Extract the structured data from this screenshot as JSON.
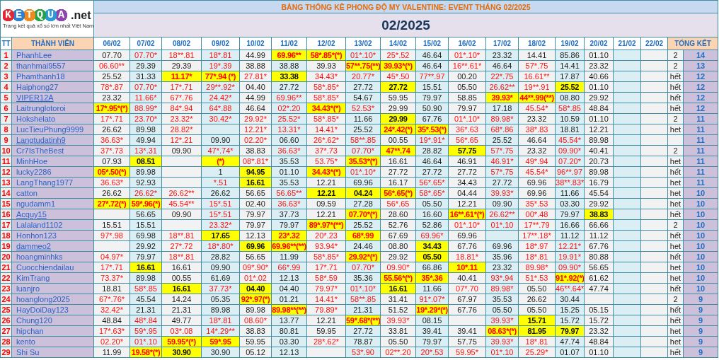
{
  "logo": {
    "letters": "KETQUA",
    "suffix": ".net",
    "tagline": "Trang kết quả xổ số lớn nhất Việt Nam"
  },
  "title": "BẢNG THỐNG KÊ PHONG ĐỘ MY VALENTINE: EVENT THÁNG 02/2025",
  "month": "02/2025",
  "columns": {
    "rank": "TT",
    "member": "THÀNH VIÊN",
    "dates": [
      "06/02",
      "07/02",
      "08/02",
      "09/02",
      "10/02",
      "11/02",
      "12/02",
      "13/02",
      "14/02",
      "15/02",
      "16/02",
      "17/02",
      "18/02",
      "19/02",
      "20/02",
      "21/02",
      "22/02"
    ],
    "summary": "TỔNG KẾT"
  },
  "rows": [
    {
      "rank": "1",
      "member": "PhanhLee",
      "link": false,
      "cells": [
        {
          "text": "07.70",
          "kind": "plain"
        },
        {
          "text": "07.70*",
          "kind": "red"
        },
        {
          "text": "18**.81",
          "kind": "red"
        },
        {
          "text": "18*.81",
          "kind": "red"
        },
        {
          "text": "44.99",
          "kind": "plain"
        },
        {
          "text": "69.96**",
          "kind": "hitred"
        },
        {
          "text": "58*.85*(*)",
          "kind": "hitred"
        },
        {
          "text": "01*.10*",
          "kind": "red"
        },
        {
          "text": "25*.52",
          "kind": "red"
        },
        {
          "text": "46.64",
          "kind": "plain"
        },
        {
          "text": "01*.10*",
          "kind": "red"
        },
        {
          "text": "23.32",
          "kind": "plain"
        },
        {
          "text": "14.41",
          "kind": "plain"
        },
        {
          "text": "85.86",
          "kind": "plain"
        },
        {
          "text": "01.10",
          "kind": "plain"
        }
      ],
      "status": "2",
      "total": "14"
    },
    {
      "rank": "2",
      "member": "thanhmai9557",
      "link": false,
      "cells": [
        {
          "text": "06.60**",
          "kind": "red"
        },
        {
          "text": "29.39",
          "kind": "plain"
        },
        {
          "text": "29.39",
          "kind": "plain"
        },
        {
          "text": "19*.39",
          "kind": "red"
        },
        {
          "text": "38.88",
          "kind": "plain"
        },
        {
          "text": "38.88",
          "kind": "plain"
        },
        {
          "text": "39.93",
          "kind": "plain"
        },
        {
          "text": "57**.75(**)",
          "kind": "hitred"
        },
        {
          "text": "39.93*(*)",
          "kind": "hitred"
        },
        {
          "text": "46.64",
          "kind": "plain"
        },
        {
          "text": "16**.61*",
          "kind": "red"
        },
        {
          "text": "46.64",
          "kind": "plain"
        },
        {
          "text": "57*.75",
          "kind": "red"
        },
        {
          "text": "14.41",
          "kind": "plain"
        },
        {
          "text": "23.32",
          "kind": "plain"
        }
      ],
      "status": "2",
      "total": "13"
    },
    {
      "rank": "3",
      "member": "Phamthanh18",
      "link": false,
      "cells": [
        {
          "text": "25.52",
          "kind": "plain"
        },
        {
          "text": "31.33",
          "kind": "plain"
        },
        {
          "text": "11.17*",
          "kind": "hitred"
        },
        {
          "text": "77*.94 (*)",
          "kind": "hitred"
        },
        {
          "text": "27.81*",
          "kind": "red"
        },
        {
          "text": "33.38",
          "kind": "hit"
        },
        {
          "text": "34.43*",
          "kind": "red"
        },
        {
          "text": "20.77*",
          "kind": "red"
        },
        {
          "text": "45*.50",
          "kind": "red"
        },
        {
          "text": "77**.97",
          "kind": "red"
        },
        {
          "text": "00.20",
          "kind": "plain"
        },
        {
          "text": "22*.75",
          "kind": "red"
        },
        {
          "text": "16.61**",
          "kind": "red"
        },
        {
          "text": "17.87",
          "kind": "plain"
        },
        {
          "text": "40.66",
          "kind": "plain"
        }
      ],
      "status": "hết",
      "total": "12"
    },
    {
      "rank": "4",
      "member": "Haiphong27",
      "link": false,
      "cells": [
        {
          "text": "78*.87",
          "kind": "red"
        },
        {
          "text": "07.70*",
          "kind": "red"
        },
        {
          "text": "17*.71",
          "kind": "red"
        },
        {
          "text": "29**.92*",
          "kind": "red"
        },
        {
          "text": "04.40",
          "kind": "plain"
        },
        {
          "text": "27.72",
          "kind": "plain"
        },
        {
          "text": "58*.85*",
          "kind": "red"
        },
        {
          "text": "27.72",
          "kind": "plain"
        },
        {
          "text": "27.72",
          "kind": "hit"
        },
        {
          "text": "15.51",
          "kind": "plain"
        },
        {
          "text": "05.50",
          "kind": "plain"
        },
        {
          "text": "26.62**",
          "kind": "red"
        },
        {
          "text": "19**.91",
          "kind": "red"
        },
        {
          "text": "25.52",
          "kind": "hit"
        },
        {
          "text": "01.10",
          "kind": "plain"
        }
      ],
      "status": "hết",
      "total": "12"
    },
    {
      "rank": "5",
      "member": "VIPER12A",
      "link": true,
      "cells": [
        {
          "text": "23.32",
          "kind": "plain"
        },
        {
          "text": "11.66*",
          "kind": "red"
        },
        {
          "text": "67*.76",
          "kind": "red"
        },
        {
          "text": "24.42*",
          "kind": "red"
        },
        {
          "text": "44.99",
          "kind": "plain"
        },
        {
          "text": "69.96**",
          "kind": "red"
        },
        {
          "text": "58*.85*",
          "kind": "red"
        },
        {
          "text": "54.67",
          "kind": "plain"
        },
        {
          "text": "59.95",
          "kind": "plain"
        },
        {
          "text": "79.97",
          "kind": "plain"
        },
        {
          "text": "58.85",
          "kind": "plain"
        },
        {
          "text": "39.93*",
          "kind": "hitred"
        },
        {
          "text": "44**.99(**)",
          "kind": "hitred"
        },
        {
          "text": "08.80",
          "kind": "plain"
        },
        {
          "text": "29.92",
          "kind": "plain"
        }
      ],
      "status": "hết",
      "total": "12"
    },
    {
      "rank": "6",
      "member": "Laitrunglotoroi",
      "link": false,
      "cells": [
        {
          "text": "17*.95*(*)",
          "kind": "hitred"
        },
        {
          "text": "88.99*",
          "kind": "red"
        },
        {
          "text": "84*.94",
          "kind": "red"
        },
        {
          "text": "64*.88",
          "kind": "red"
        },
        {
          "text": "46.64",
          "kind": "plain"
        },
        {
          "text": "02*.20",
          "kind": "red"
        },
        {
          "text": "34.43*(*)",
          "kind": "hitred"
        },
        {
          "text": "52.53*",
          "kind": "red"
        },
        {
          "text": "29.99",
          "kind": "plain"
        },
        {
          "text": "50.90",
          "kind": "plain"
        },
        {
          "text": "79.97",
          "kind": "plain"
        },
        {
          "text": "17.18",
          "kind": "plain"
        },
        {
          "text": "45.54*",
          "kind": "red"
        },
        {
          "text": "58*.85",
          "kind": "red"
        },
        {
          "text": "48.84",
          "kind": "plain"
        }
      ],
      "status": "hết",
      "total": "12"
    },
    {
      "rank": "7",
      "member": "Hokshelato",
      "link": false,
      "cells": [
        {
          "text": "17*.71",
          "kind": "red"
        },
        {
          "text": "23.70*",
          "kind": "red"
        },
        {
          "text": "23.32*",
          "kind": "red"
        },
        {
          "text": "30.42*",
          "kind": "red"
        },
        {
          "text": "29.92*",
          "kind": "red"
        },
        {
          "text": "25.52*",
          "kind": "red"
        },
        {
          "text": "58*.85*",
          "kind": "red"
        },
        {
          "text": "11.66",
          "kind": "plain"
        },
        {
          "text": "29.99",
          "kind": "hit"
        },
        {
          "text": "67.76",
          "kind": "plain"
        },
        {
          "text": "01*.10*",
          "kind": "red"
        },
        {
          "text": "89.98*",
          "kind": "red"
        },
        {
          "text": "23.32",
          "kind": "plain"
        },
        {
          "text": "10.59",
          "kind": "plain"
        },
        {
          "text": "01.10",
          "kind": "plain"
        }
      ],
      "status": "2",
      "total": "11"
    },
    {
      "rank": "8",
      "member": "LucTieuPhung9999",
      "link": false,
      "cells": [
        {
          "text": "26.62",
          "kind": "plain"
        },
        {
          "text": "89.98",
          "kind": "plain"
        },
        {
          "text": "28.82*",
          "kind": "red"
        },
        null,
        {
          "text": "12.21*",
          "kind": "red"
        },
        {
          "text": "13.31*",
          "kind": "red"
        },
        {
          "text": "14.41*",
          "kind": "red"
        },
        {
          "text": "25.52",
          "kind": "plain"
        },
        {
          "text": "24*.42(*)",
          "kind": "hitred"
        },
        {
          "text": "35*.53(*)",
          "kind": "hitred"
        },
        {
          "text": "36*.63",
          "kind": "red"
        },
        {
          "text": "68*.86",
          "kind": "red"
        },
        {
          "text": "38*.83",
          "kind": "red"
        },
        {
          "text": "18.81",
          "kind": "plain"
        },
        {
          "text": "12.21",
          "kind": "plain"
        }
      ],
      "status": "het",
      "total": "11"
    },
    {
      "rank": "9",
      "member": "Langtudatinh9",
      "link": true,
      "cells": [
        {
          "text": "36.63*",
          "kind": "red"
        },
        {
          "text": "49.94",
          "kind": "plain"
        },
        {
          "text": "12*.21",
          "kind": "red"
        },
        {
          "text": "09.90",
          "kind": "plain"
        },
        {
          "text": "02.20*",
          "kind": "red"
        },
        {
          "text": "06.60",
          "kind": "plain"
        },
        {
          "text": "26*.62*",
          "kind": "red"
        },
        {
          "text": "58**.85",
          "kind": "red"
        },
        {
          "text": "00.55",
          "kind": "plain"
        },
        {
          "text": "19*.91*",
          "kind": "red"
        },
        {
          "text": "56*.65",
          "kind": "red"
        },
        {
          "text": "25.52",
          "kind": "plain"
        },
        {
          "text": "46.64",
          "kind": "plain"
        },
        {
          "text": "45.54*",
          "kind": "red"
        },
        {
          "text": "89.98",
          "kind": "plain"
        }
      ],
      "total": "11"
    },
    {
      "rank": "10",
      "member": "Cr7IsTheBest",
      "link": false,
      "cells": [
        {
          "text": "37*.73",
          "kind": "red"
        },
        {
          "text": "13*.31",
          "kind": "red"
        },
        {
          "text": "09.90",
          "kind": "plain"
        },
        {
          "text": "47*.74*",
          "kind": "red"
        },
        {
          "text": "38.83",
          "kind": "plain"
        },
        {
          "text": "36.63*",
          "kind": "red"
        },
        {
          "text": "37*.73",
          "kind": "red"
        },
        {
          "text": "07.70*",
          "kind": "red"
        },
        {
          "text": "47**.74",
          "kind": "hitred"
        },
        {
          "text": "28.82",
          "kind": "plain"
        },
        {
          "text": "57.75",
          "kind": "hit"
        },
        {
          "text": "57*.75",
          "kind": "red"
        },
        {
          "text": "23.32",
          "kind": "plain"
        },
        {
          "text": "09.90*",
          "kind": "red"
        },
        {
          "text": "40.41",
          "kind": "plain"
        }
      ],
      "status": "2",
      "total": "11"
    },
    {
      "rank": "11",
      "member": "MinhHoe",
      "link": false,
      "cells": [
        {
          "text": "07.93",
          "kind": "plain"
        },
        {
          "text": "08.51",
          "kind": "hit"
        },
        null,
        {
          "text": "(*)",
          "kind": "hitred"
        },
        {
          "text": "08*.81*",
          "kind": "red"
        },
        {
          "text": "35.53",
          "kind": "plain"
        },
        {
          "text": "53.75*",
          "kind": "red"
        },
        {
          "text": "35.53*(*)",
          "kind": "hitred"
        },
        {
          "text": "16.61",
          "kind": "plain"
        },
        {
          "text": "46.64",
          "kind": "plain"
        },
        {
          "text": "46.91",
          "kind": "plain"
        },
        {
          "text": "46.91*",
          "kind": "red"
        },
        {
          "text": "49*.94",
          "kind": "red"
        },
        {
          "text": "07.20*",
          "kind": "red"
        },
        {
          "text": "20.73",
          "kind": "plain"
        }
      ],
      "status": "het",
      "total": "11"
    },
    {
      "rank": "12",
      "member": "lucky2286",
      "link": false,
      "cells": [
        {
          "text": "05*.50(*)",
          "kind": "hitred"
        },
        {
          "text": "89.98",
          "kind": "plain"
        },
        null,
        {
          "text": "1",
          "kind": "plain"
        },
        {
          "text": "94.95",
          "kind": "hit"
        },
        {
          "text": "01.10",
          "kind": "plain"
        },
        {
          "text": "34.43*(*)",
          "kind": "hitred"
        },
        {
          "text": "01*.10*",
          "kind": "red"
        },
        {
          "text": "27.72",
          "kind": "plain"
        },
        {
          "text": "27.72",
          "kind": "plain"
        },
        {
          "text": "27.72",
          "kind": "plain"
        },
        {
          "text": "57*.75",
          "kind": "red"
        },
        {
          "text": "45.54*",
          "kind": "red"
        },
        {
          "text": "96**.97",
          "kind": "red"
        },
        {
          "text": "89.98",
          "kind": "plain"
        }
      ],
      "status": "hết",
      "total": "11"
    },
    {
      "rank": "13",
      "member": "LangThang1977",
      "link": false,
      "cells": [
        {
          "text": "36.63*",
          "kind": "red"
        },
        {
          "text": "92.93",
          "kind": "plain"
        },
        null,
        {
          "text": "*.51",
          "kind": "red"
        },
        {
          "text": "16.61",
          "kind": "hit"
        },
        {
          "text": "35.53",
          "kind": "plain"
        },
        {
          "text": "12.21",
          "kind": "plain"
        },
        {
          "text": "69.96",
          "kind": "plain"
        },
        {
          "text": "16.17",
          "kind": "plain"
        },
        {
          "text": "56*.65*",
          "kind": "red"
        },
        {
          "text": "34.43",
          "kind": "plain"
        },
        {
          "text": "27.72",
          "kind": "plain"
        },
        {
          "text": "69.96",
          "kind": "plain"
        },
        {
          "text": "38**.83*",
          "kind": "red"
        },
        {
          "text": "16.79",
          "kind": "plain"
        }
      ],
      "status": "het",
      "total": "11"
    },
    {
      "rank": "14",
      "member": "catton",
      "link": false,
      "cells": [
        {
          "text": "26.62",
          "kind": "plain"
        },
        {
          "text": "26.62*",
          "kind": "red"
        },
        {
          "text": "26.62**",
          "kind": "red"
        },
        {
          "text": "26.62",
          "kind": "plain"
        },
        {
          "text": "56.65",
          "kind": "plain"
        },
        {
          "text": "56.65**",
          "kind": "red"
        },
        {
          "text": "12.21",
          "kind": "hit"
        },
        {
          "text": "04.24",
          "kind": "hit"
        },
        {
          "text": "56*.65(*)",
          "kind": "hitred"
        },
        {
          "text": "58*.65*",
          "kind": "red"
        },
        {
          "text": "04.44",
          "kind": "plain"
        },
        {
          "text": "39.93*",
          "kind": "red"
        },
        {
          "text": "69.96",
          "kind": "plain"
        },
        {
          "text": "11.66",
          "kind": "plain"
        },
        {
          "text": "45.54",
          "kind": "plain"
        }
      ],
      "status": "het",
      "total": "10"
    },
    {
      "rank": "15",
      "member": "ngudamm1",
      "link": false,
      "cells": [
        {
          "text": "27*.72(*)",
          "kind": "hitred"
        },
        {
          "text": "59*.96(*)",
          "kind": "hitred"
        },
        {
          "text": "45.54**",
          "kind": "red"
        },
        {
          "text": "15*.51",
          "kind": "red"
        },
        {
          "text": "02.40",
          "kind": "plain"
        },
        {
          "text": "36.63*",
          "kind": "red"
        },
        {
          "text": "09.59",
          "kind": "plain"
        },
        {
          "text": "27.28",
          "kind": "plain"
        },
        {
          "text": "56*.65",
          "kind": "red"
        },
        {
          "text": "05.50",
          "kind": "plain"
        },
        {
          "text": "12.21",
          "kind": "plain"
        },
        {
          "text": "09.90",
          "kind": "plain"
        },
        {
          "text": "35*.53",
          "kind": "red"
        },
        {
          "text": "03.30",
          "kind": "plain"
        },
        {
          "text": "29.92",
          "kind": "plain"
        }
      ],
      "status": "het",
      "total": "10"
    },
    {
      "rank": "16",
      "member": "Acquy15",
      "link": true,
      "cells": [
        null,
        {
          "text": "56.65",
          "kind": "plain"
        },
        {
          "text": "09.90",
          "kind": "plain"
        },
        {
          "text": "15*.51",
          "kind": "red"
        },
        {
          "text": "79.97",
          "kind": "plain"
        },
        {
          "text": "37.73",
          "kind": "plain"
        },
        {
          "text": "12.21",
          "kind": "plain"
        },
        {
          "text": "07.70*(*)",
          "kind": "hitred"
        },
        {
          "text": "28.60",
          "kind": "plain"
        },
        {
          "text": "16.60",
          "kind": "plain"
        },
        {
          "text": "16**.61*(*)",
          "kind": "hitred"
        },
        {
          "text": "26.62**",
          "kind": "red"
        },
        {
          "text": "00*.48",
          "kind": "red"
        },
        {
          "text": "79.97",
          "kind": "plain"
        },
        {
          "text": "38.83",
          "kind": "hit"
        }
      ],
      "status": "hết",
      "total": "10"
    },
    {
      "rank": "17",
      "member": "Lalaland1102",
      "link": false,
      "cells": [
        {
          "text": "15.51",
          "kind": "plain"
        },
        {
          "text": "15.51",
          "kind": "plain"
        },
        null,
        {
          "text": "23.32*",
          "kind": "red"
        },
        {
          "text": "79.97",
          "kind": "plain"
        },
        {
          "text": "79.97",
          "kind": "plain"
        },
        {
          "text": "89*.97*(**)",
          "kind": "hitred"
        },
        {
          "text": "25.52",
          "kind": "plain"
        },
        {
          "text": "52.76",
          "kind": "plain"
        },
        {
          "text": "52.86",
          "kind": "plain"
        },
        {
          "text": "01*.10*",
          "kind": "red"
        },
        {
          "text": "01*.10",
          "kind": "red"
        },
        {
          "text": "17**.79",
          "kind": "red"
        },
        {
          "text": "16.66",
          "kind": "plain"
        },
        {
          "text": "66.66",
          "kind": "plain"
        }
      ],
      "status": "2",
      "total": "10"
    },
    {
      "rank": "18",
      "member": "Honhon123",
      "link": false,
      "cells": [
        {
          "text": "97*.98",
          "kind": "red"
        },
        {
          "text": "69.98",
          "kind": "plain"
        },
        {
          "text": "18**.81",
          "kind": "red"
        },
        {
          "text": "17.65",
          "kind": "hit"
        },
        {
          "text": "12.13",
          "kind": "plain"
        },
        {
          "text": "23*.32",
          "kind": "hitred"
        },
        {
          "text": "20*.23",
          "kind": "red"
        },
        {
          "text": "68*.99",
          "kind": "hitred"
        },
        {
          "text": "67.69",
          "kind": "plain"
        },
        {
          "text": "69.96*",
          "kind": "red"
        },
        {
          "text": "69.96",
          "kind": "plain"
        },
        null,
        {
          "text": "17**.18*",
          "kind": "red"
        },
        {
          "text": "11.12",
          "kind": "plain"
        },
        {
          "text": "11.12",
          "kind": "plain"
        }
      ],
      "status": "hết",
      "total": "10"
    },
    {
      "rank": "19",
      "member": "dammeo2",
      "link": true,
      "cells": [
        null,
        {
          "text": "29.92",
          "kind": "plain"
        },
        {
          "text": "27*.72",
          "kind": "red"
        },
        {
          "text": "18*.80*",
          "kind": "red"
        },
        {
          "text": "69.96",
          "kind": "hit"
        },
        {
          "text": "69.96**(**)",
          "kind": "hitred"
        },
        {
          "text": "93.94*",
          "kind": "red"
        },
        {
          "text": "24.46",
          "kind": "plain"
        },
        {
          "text": "08.80",
          "kind": "plain"
        },
        {
          "text": "34.43",
          "kind": "hit"
        },
        {
          "text": "67.76",
          "kind": "plain"
        },
        {
          "text": "69.96",
          "kind": "plain"
        },
        {
          "text": "18*.97",
          "kind": "red"
        },
        {
          "text": "12.21*",
          "kind": "red"
        },
        {
          "text": "67.76",
          "kind": "plain"
        }
      ],
      "status": "het",
      "total": "10"
    },
    {
      "rank": "20",
      "member": "hoangminhks",
      "link": false,
      "cells": [
        {
          "text": "04.97*",
          "kind": "red"
        },
        {
          "text": "79.97",
          "kind": "plain"
        },
        {
          "text": "18**.81",
          "kind": "red"
        },
        {
          "text": "28.82",
          "kind": "plain"
        },
        {
          "text": "56.65",
          "kind": "plain"
        },
        {
          "text": "11.99",
          "kind": "plain"
        },
        {
          "text": "58*.85*",
          "kind": "red"
        },
        {
          "text": "29.92*(*)",
          "kind": "hitred"
        },
        {
          "text": "29.92",
          "kind": "plain"
        },
        {
          "text": "05.50",
          "kind": "hit"
        },
        {
          "text": "18.81*",
          "kind": "red"
        },
        {
          "text": "35.96",
          "kind": "plain"
        },
        {
          "text": "18*.81",
          "kind": "red"
        },
        {
          "text": "19.91*",
          "kind": "red"
        },
        {
          "text": "80.88",
          "kind": "plain"
        }
      ],
      "status": "hết",
      "total": "10"
    },
    {
      "rank": "21",
      "member": "Cuocchiendailau",
      "link": false,
      "cells": [
        {
          "text": "17*.71",
          "kind": "red"
        },
        {
          "text": "16.61",
          "kind": "hit"
        },
        {
          "text": "16.61",
          "kind": "plain"
        },
        {
          "text": "09.90",
          "kind": "plain"
        },
        {
          "text": "09*.90*",
          "kind": "red"
        },
        {
          "text": "66*.99",
          "kind": "red"
        },
        {
          "text": "17*.71",
          "kind": "red"
        },
        {
          "text": "07.70*",
          "kind": "red"
        },
        {
          "text": "09.90*",
          "kind": "red"
        },
        {
          "text": "66.86",
          "kind": "plain"
        },
        {
          "text": "10*.11",
          "kind": "hitred"
        },
        {
          "text": "23.32",
          "kind": "plain"
        },
        {
          "text": "89.98*",
          "kind": "red"
        },
        {
          "text": "09.90*",
          "kind": "red"
        },
        {
          "text": "56.65",
          "kind": "plain"
        }
      ],
      "status": "het",
      "total": "10"
    },
    {
      "rank": "22",
      "member": "KimTrang",
      "link": false,
      "cells": [
        {
          "text": "73.37*",
          "kind": "red"
        },
        {
          "text": "89.98",
          "kind": "plain"
        },
        {
          "text": "00.55",
          "kind": "plain"
        },
        {
          "text": "61.69",
          "kind": "plain"
        },
        {
          "text": "01*.02",
          "kind": "red"
        },
        {
          "text": "12.13",
          "kind": "plain"
        },
        {
          "text": "58*.59",
          "kind": "red"
        },
        {
          "text": "35.36",
          "kind": "plain"
        },
        {
          "text": "55.56*(*)",
          "kind": "hitred"
        },
        {
          "text": "35*.36",
          "kind": "hitred"
        },
        {
          "text": "40.41",
          "kind": "plain"
        },
        {
          "text": "93*.94",
          "kind": "red"
        },
        {
          "text": "51*.53",
          "kind": "red"
        },
        {
          "text": "91*.92(*)",
          "kind": "hitred"
        },
        {
          "text": "61.62",
          "kind": "plain"
        }
      ],
      "status": "het",
      "total": "10"
    },
    {
      "rank": "23",
      "member": "luanjro",
      "link": false,
      "cells": [
        {
          "text": "18.81",
          "kind": "plain"
        },
        {
          "text": "58*.85",
          "kind": "red"
        },
        {
          "text": "16.61",
          "kind": "hit"
        },
        {
          "text": "37.73*",
          "kind": "red"
        },
        {
          "text": "04.40",
          "kind": "hit"
        },
        {
          "text": "04.40",
          "kind": "plain"
        },
        {
          "text": "79.97*",
          "kind": "red"
        },
        {
          "text": "01*.10*",
          "kind": "red"
        },
        {
          "text": "16.61",
          "kind": "hit"
        },
        {
          "text": "11.66",
          "kind": "plain"
        },
        {
          "text": "07*.70",
          "kind": "red"
        },
        {
          "text": "89.98*",
          "kind": "red"
        },
        {
          "text": "05.50",
          "kind": "plain"
        },
        {
          "text": "46**.64*",
          "kind": "red"
        },
        {
          "text": "47.74",
          "kind": "plain"
        }
      ],
      "status": "hết",
      "total": "10"
    },
    {
      "rank": "24",
      "member": "hoanglong2025",
      "link": false,
      "cells": [
        {
          "text": "67*.76*",
          "kind": "red"
        },
        {
          "text": "45.54",
          "kind": "plain"
        },
        {
          "text": "14.24",
          "kind": "plain"
        },
        {
          "text": "05.35",
          "kind": "plain"
        },
        {
          "text": "92*.97(*)",
          "kind": "hitred"
        },
        {
          "text": "01.21",
          "kind": "plain"
        },
        {
          "text": "14.41*",
          "kind": "red"
        },
        {
          "text": "58**.85",
          "kind": "red"
        },
        {
          "text": "31.41",
          "kind": "plain"
        },
        {
          "text": "91*.07*",
          "kind": "red"
        },
        {
          "text": "67.97",
          "kind": "plain"
        },
        {
          "text": "35.53",
          "kind": "plain"
        },
        {
          "text": "26.62",
          "kind": "plain"
        },
        {
          "text": "30.44",
          "kind": "plain"
        },
        null
      ],
      "status": "2",
      "total": "9"
    },
    {
      "rank": "25",
      "member": "HayDoiDay123",
      "link": false,
      "cells": [
        {
          "text": "32.42*",
          "kind": "red"
        },
        {
          "text": "21.31",
          "kind": "plain"
        },
        {
          "text": "21.31",
          "kind": "plain"
        },
        {
          "text": "89.98",
          "kind": "plain"
        },
        {
          "text": "89.98",
          "kind": "plain"
        },
        {
          "text": "89.98**(**)",
          "kind": "hitred"
        },
        {
          "text": "79.89*",
          "kind": "red"
        },
        {
          "text": "21.31",
          "kind": "plain"
        },
        {
          "text": "51.52",
          "kind": "plain"
        },
        {
          "text": "19*.29*(*)",
          "kind": "hitred"
        },
        {
          "text": "67.76",
          "kind": "plain"
        },
        {
          "text": "05.50",
          "kind": "plain"
        },
        {
          "text": "05.50",
          "kind": "plain"
        },
        {
          "text": "15.25",
          "kind": "plain"
        },
        {
          "text": "05.15",
          "kind": "plain"
        }
      ],
      "status": "hết",
      "total": "9"
    },
    {
      "rank": "26",
      "member": "Chung120",
      "link": false,
      "cells": [
        {
          "text": "48.84",
          "kind": "plain"
        },
        {
          "text": "48*.84",
          "kind": "red"
        },
        {
          "text": "49.77",
          "kind": "plain"
        },
        {
          "text": "18*.81",
          "kind": "red"
        },
        {
          "text": "08.60*",
          "kind": "red"
        },
        {
          "text": "13.77",
          "kind": "plain"
        },
        {
          "text": "12.21",
          "kind": "plain"
        },
        {
          "text": "59*.68*(**)",
          "kind": "hitred"
        },
        {
          "text": "39.93*",
          "kind": "red"
        },
        {
          "text": "08.15",
          "kind": "plain"
        },
        null,
        {
          "text": "39.93*",
          "kind": "red"
        },
        {
          "text": "15.71",
          "kind": "hit"
        },
        {
          "text": "15.72",
          "kind": "plain"
        },
        {
          "text": "15.72",
          "kind": "plain"
        }
      ],
      "status": "hết",
      "total": "9"
    },
    {
      "rank": "27",
      "member": "hipchan",
      "link": false,
      "cells": [
        {
          "text": "17*.63*",
          "kind": "red"
        },
        {
          "text": "59*.95",
          "kind": "red"
        },
        {
          "text": "03*.08",
          "kind": "red"
        },
        {
          "text": "14*.29**",
          "kind": "red"
        },
        {
          "text": "38.83",
          "kind": "plain"
        },
        {
          "text": "80.81",
          "kind": "plain"
        },
        {
          "text": "59.95",
          "kind": "plain"
        },
        {
          "text": "27.72",
          "kind": "plain"
        },
        {
          "text": "33.81",
          "kind": "plain"
        },
        {
          "text": "39.41",
          "kind": "plain"
        },
        {
          "text": "39.41",
          "kind": "plain"
        },
        {
          "text": "08.63*(*)",
          "kind": "hitred"
        },
        {
          "text": "81.95",
          "kind": "hit"
        },
        {
          "text": "79.97",
          "kind": "hit"
        },
        {
          "text": "23.32",
          "kind": "plain"
        }
      ],
      "status": "het",
      "total": "9"
    },
    {
      "rank": "28",
      "member": "kento",
      "link": false,
      "cells": [
        {
          "text": "02.20*",
          "kind": "red"
        },
        {
          "text": "01*.10",
          "kind": "red"
        },
        {
          "text": "59.95*(*)",
          "kind": "hitred"
        },
        {
          "text": "59*.95",
          "kind": "hitred"
        },
        {
          "text": "59.95",
          "kind": "plain"
        },
        {
          "text": "03.30",
          "kind": "plain"
        },
        {
          "text": "28*.62*",
          "kind": "red"
        },
        {
          "text": "78.87",
          "kind": "plain"
        },
        {
          "text": "05.50",
          "kind": "plain"
        },
        {
          "text": "79.97",
          "kind": "plain"
        },
        {
          "text": "57.75",
          "kind": "plain"
        },
        {
          "text": "39.93*",
          "kind": "red"
        },
        {
          "text": "18*.81",
          "kind": "red"
        },
        {
          "text": "47.74",
          "kind": "plain"
        },
        {
          "text": "48.84",
          "kind": "plain"
        }
      ],
      "status": "het",
      "total": "9"
    },
    {
      "rank": "29",
      "member": "Shi Su",
      "link": false,
      "cells": [
        {
          "text": "11.99",
          "kind": "plain"
        },
        {
          "text": "19.58*(*)",
          "kind": "hitred"
        },
        {
          "text": "30.90",
          "kind": "hit"
        },
        {
          "text": "30.90",
          "kind": "plain"
        },
        {
          "text": "05.12",
          "kind": "plain"
        },
        {
          "text": "12.13",
          "kind": "plain"
        },
        null,
        {
          "text": "53*.90",
          "kind": "red"
        },
        {
          "text": "02**.20",
          "kind": "red"
        },
        {
          "text": "20*.53",
          "kind": "red"
        },
        {
          "text": "59.95*",
          "kind": "red"
        },
        {
          "text": "01*.10",
          "kind": "red"
        },
        {
          "text": "25.29*",
          "kind": "red"
        },
        {
          "text": "01.07",
          "kind": "plain"
        },
        {
          "text": "01.10",
          "kind": "plain"
        }
      ],
      "status": "hết",
      "total": "9"
    }
  ]
}
